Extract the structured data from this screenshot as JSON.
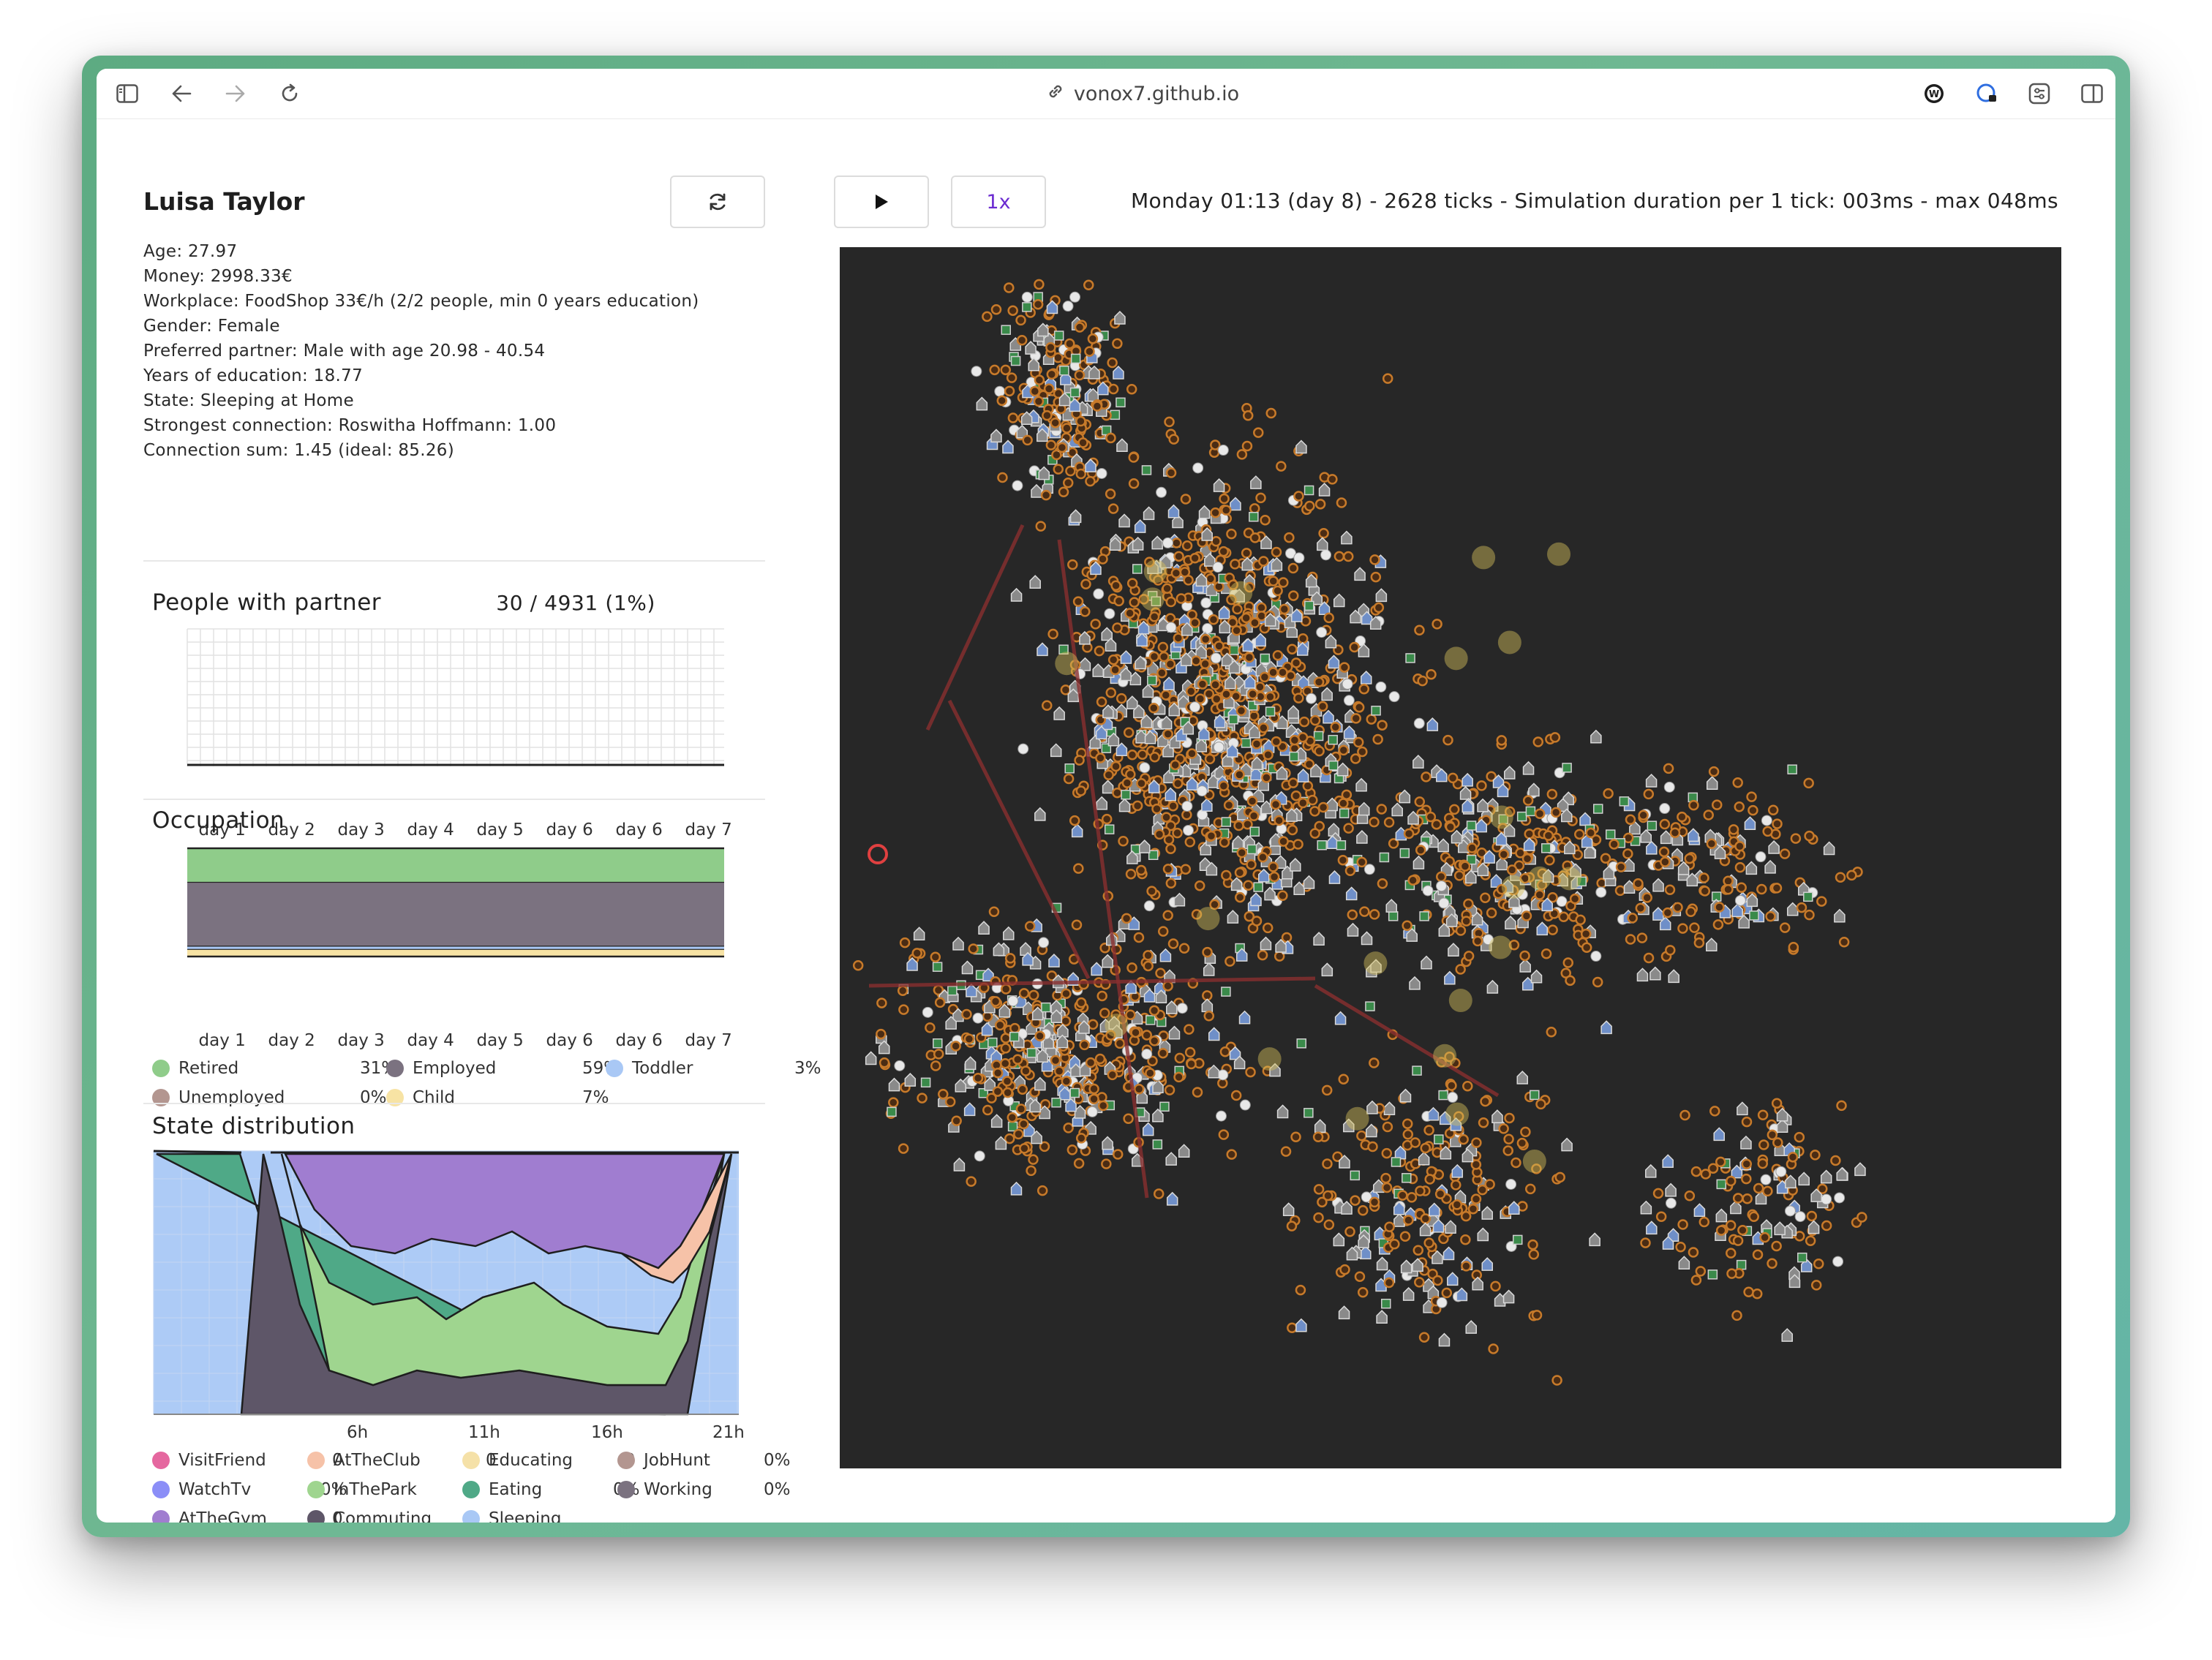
{
  "browser": {
    "url": "vonox7.github.io"
  },
  "person": {
    "name": "Luisa Taylor",
    "details": [
      "Age: 27.97",
      "Money: 2998.33€",
      "Workplace: FoodShop 33€/h (2/2 people, min 0 years education)",
      "Gender: Female",
      "Preferred partner: Male with age 20.98 - 40.54",
      "Years of education: 18.77",
      "State: Sleeping at Home",
      "Strongest connection: Roswitha Hoffmann: 1.00",
      "Connection sum: 1.45 (ideal: 85.26)"
    ]
  },
  "controls": {
    "speed_label": "1x",
    "status": "Monday 01:13 (day 8) - 2628 ticks - Simulation duration per 1 tick: 003ms - max 048ms"
  },
  "partner_chart": {
    "title": "People with partner",
    "stat": "30 / 4931 (1%)",
    "chart_data": {
      "type": "line",
      "x": [
        "day 1",
        "day 2",
        "day 3",
        "day 4",
        "day 5",
        "day 6",
        "day 6",
        "day 7"
      ],
      "series": [
        {
          "values": [
            0,
            0,
            0,
            0,
            0,
            0,
            0,
            0
          ]
        }
      ],
      "grid": true
    }
  },
  "occupation": {
    "title": "Occupation",
    "chart_data": {
      "type": "area",
      "x": [
        "day 1",
        "day 2",
        "day 3",
        "day 4",
        "day 5",
        "day 6",
        "day 6",
        "day 7"
      ],
      "series": [
        {
          "name": "Retired",
          "values": [
            31,
            31,
            31,
            31,
            31,
            31,
            31,
            31
          ]
        },
        {
          "name": "Employed",
          "values": [
            59,
            59,
            59,
            59,
            59,
            59,
            59,
            59
          ]
        },
        {
          "name": "Toddler",
          "values": [
            3,
            3,
            3,
            3,
            3,
            3,
            3,
            3
          ]
        },
        {
          "name": "Unemployed",
          "values": [
            0,
            0,
            0,
            0,
            0,
            0,
            0,
            0
          ]
        },
        {
          "name": "Child",
          "values": [
            7,
            7,
            7,
            7,
            7,
            7,
            7,
            7
          ]
        }
      ]
    },
    "legend": [
      {
        "label": "Retired",
        "pct": "31%",
        "color": "#8fcc8a"
      },
      {
        "label": "Employed",
        "pct": "59%",
        "color": "#7b7280"
      },
      {
        "label": "Toddler",
        "pct": "3%",
        "color": "#a9c8f5"
      },
      {
        "label": "Unemployed",
        "pct": "0%",
        "color": "#b39690"
      },
      {
        "label": "Child",
        "pct": "7%",
        "color": "#f7e3a4"
      }
    ]
  },
  "state_distribution": {
    "title": "State distribution",
    "chart_data": {
      "type": "area",
      "x_ticks": [
        "6h",
        "11h",
        "16h",
        "21h"
      ],
      "series_order": [
        "Sleeping",
        "Eating",
        "Commuting",
        "InThePark",
        "AtTheGym",
        "AtTheClub"
      ]
    },
    "legend": [
      {
        "label": "VisitFriend",
        "pct": "0",
        "color": "#e5679f"
      },
      {
        "label": "AtTheClub",
        "pct": "0",
        "color": "#f6c2a8"
      },
      {
        "label": "Educating",
        "pct": "0",
        "color": "#f5e1a8"
      },
      {
        "label": "JobHunt",
        "pct": "0%",
        "color": "#b39690"
      },
      {
        "label": "WatchTv",
        "pct": "0%",
        "color": "#8b8ef7"
      },
      {
        "label": "InThePark",
        "pct": "",
        "color": "#9fd58f"
      },
      {
        "label": "Eating",
        "pct": "0%",
        "color": "#4fa987"
      },
      {
        "label": "Working",
        "pct": "0%",
        "color": "#7b7280"
      },
      {
        "label": "AtTheGym",
        "pct": "0",
        "color": "#a07dd0"
      },
      {
        "label": "Commuting",
        "pct": "",
        "color": "#5e5668"
      },
      {
        "label": "Sleeping",
        "pct": "",
        "color": "#a9c8f5"
      }
    ]
  },
  "colors": {
    "map_bg": "#272727",
    "accent": "#6b2bd1"
  }
}
